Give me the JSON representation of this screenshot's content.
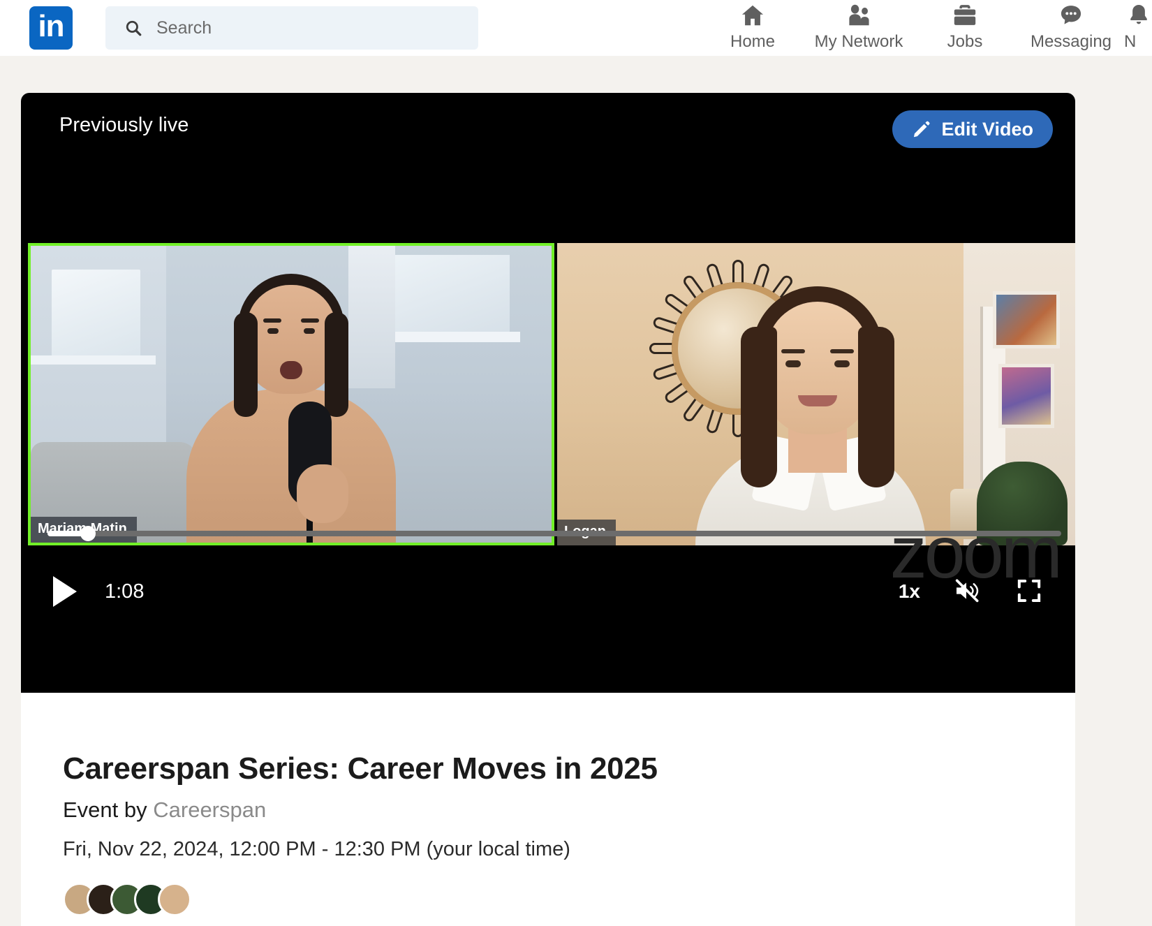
{
  "nav": {
    "logo_alt": "LinkedIn",
    "logo_text": "in",
    "search_placeholder": "Search",
    "search_value": "",
    "items": [
      {
        "label": "Home",
        "icon": "home-icon"
      },
      {
        "label": "My Network",
        "icon": "people-icon"
      },
      {
        "label": "Jobs",
        "icon": "briefcase-icon"
      },
      {
        "label": "Messaging",
        "icon": "message-bubble-icon"
      },
      {
        "label": "N",
        "icon": "bell-icon"
      }
    ]
  },
  "player": {
    "status_label": "Previously live",
    "edit_button_label": "Edit Video",
    "edit_button_icon": "pencil-icon",
    "watermark": "zoom",
    "current_time": "1:08",
    "progress_percent": 4,
    "playback_speed": "1x",
    "play_icon": "play-icon",
    "volume_icon": "volume-muted-icon",
    "fullscreen_icon": "fullscreen-icon",
    "active_speaker_color": "#72f028",
    "accent_color": "#2e69b8",
    "participants": [
      {
        "name": "Mariam Matin",
        "active_speaker": true
      },
      {
        "name": "Logan",
        "active_speaker": false
      }
    ]
  },
  "event": {
    "title": "Careerspan Series: Career Moves in 2025",
    "by_prefix": "Event by ",
    "organizer": "Careerspan",
    "date": "Fri, Nov 22, 2024, 12:00 PM - 12:30 PM (your local time)",
    "attendee_avatar_colors": [
      "#c8a882",
      "#2b2018",
      "#3c5a34",
      "#1f3a22",
      "#d6b28c"
    ]
  }
}
